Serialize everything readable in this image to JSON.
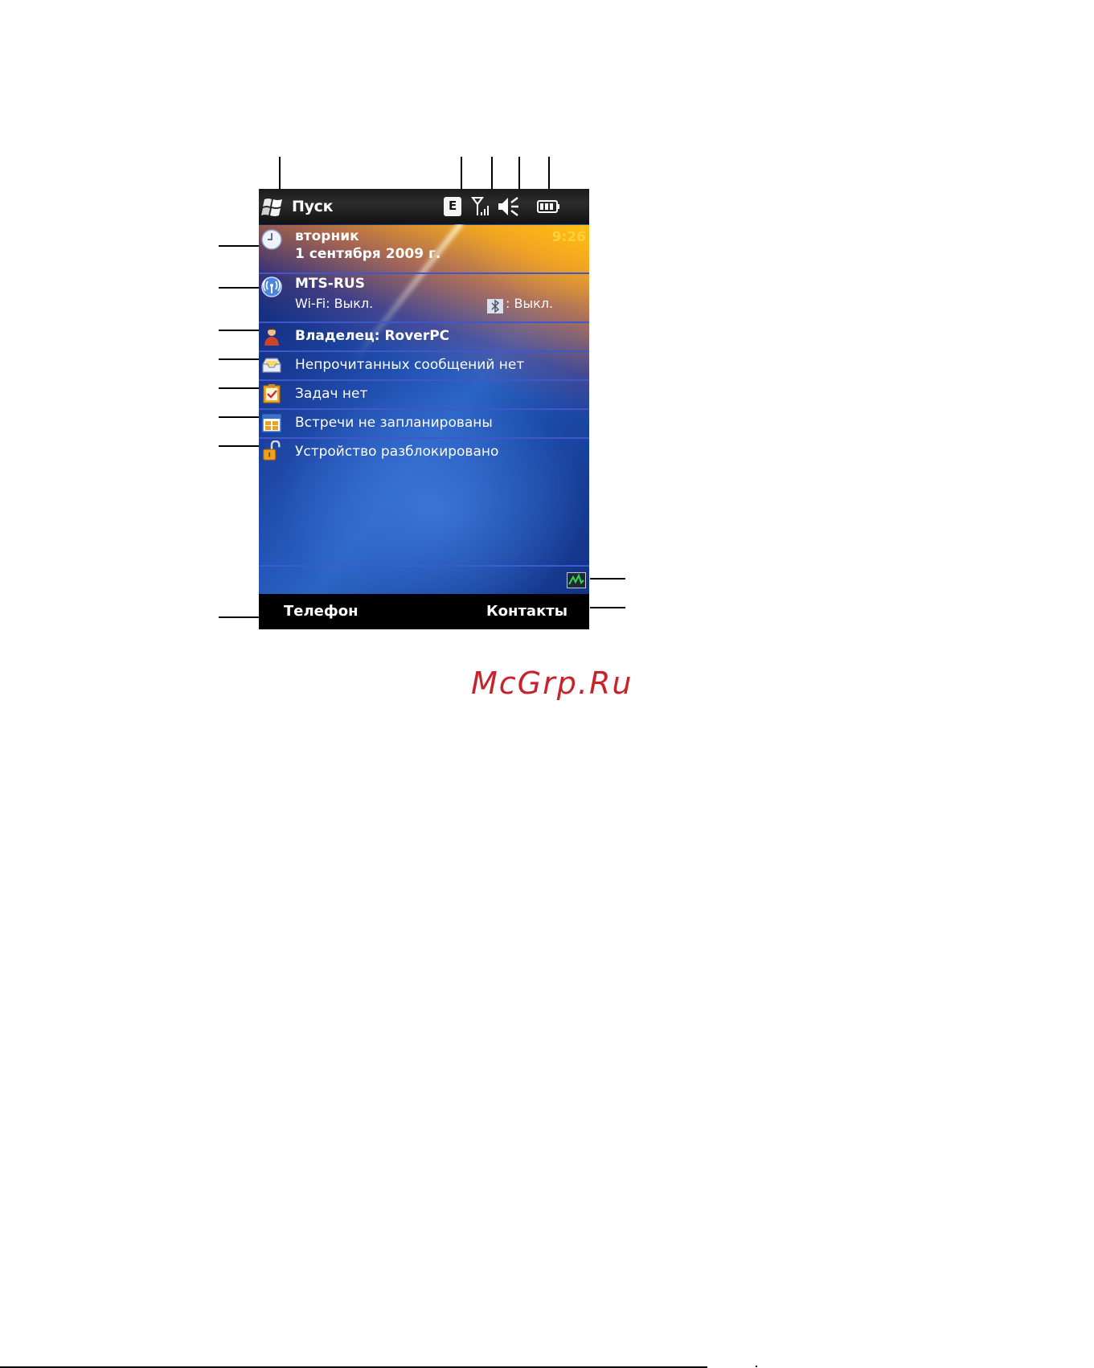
{
  "topbar": {
    "start_label": "Пуск",
    "edge_badge": "E"
  },
  "today": {
    "date": {
      "day": "вторник",
      "full_date": "1 сентября 2009 г.",
      "time": "9:26"
    },
    "network": {
      "operator": "MTS-RUS",
      "wifi_status": "Wi-Fi: Выкл.",
      "bluetooth_status": ": Выкл."
    },
    "owner": {
      "label": "Владелец: RoverPC"
    },
    "messages": {
      "label": "Непрочитанных сообщений нет"
    },
    "tasks": {
      "label": "Задач нет"
    },
    "calendar": {
      "label": "Встречи не запланированы"
    },
    "lock": {
      "label": "Устройство разблокировано"
    }
  },
  "softkeys": {
    "left": "Телефон",
    "right": "Контакты"
  },
  "watermark": "McGrp.Ru",
  "colors": {
    "time": "#ffd23a",
    "separator": "#3f57c8",
    "watermark": "#c8232c"
  },
  "icons": [
    "windows-start-icon",
    "edge-icon",
    "signal-icon",
    "volume-muted-icon",
    "battery-icon",
    "clock-icon",
    "wireless-icon",
    "owner-icon",
    "inbox-icon",
    "tasks-icon",
    "calendar-icon",
    "unlocked-icon",
    "activity-monitor-icon"
  ]
}
